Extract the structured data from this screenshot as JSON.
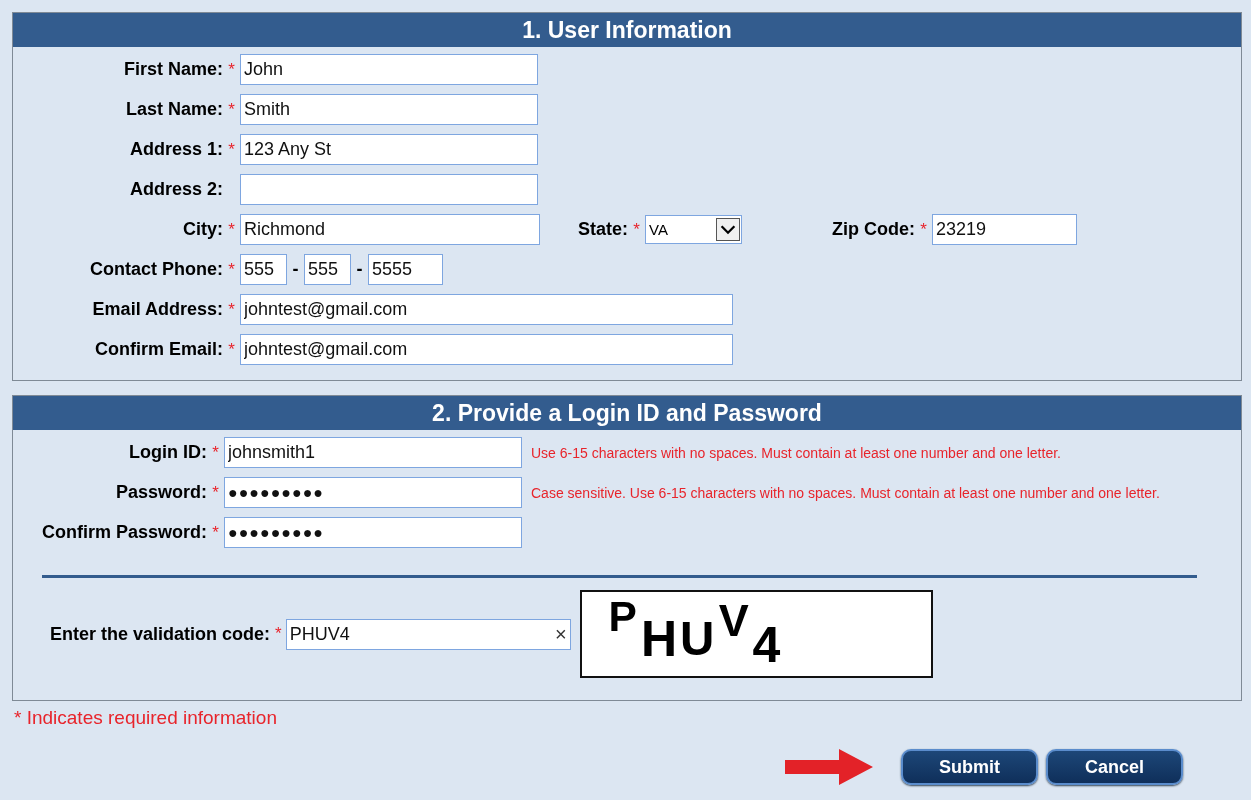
{
  "sections": [
    {
      "title": "1. User Information",
      "rows": [
        {
          "kind": "text",
          "label": "First Name:",
          "mark": "*",
          "value": "John"
        },
        {
          "kind": "text",
          "label": "Last Name:",
          "mark": "*",
          "value": "Smith"
        },
        {
          "kind": "text",
          "label": "Address 1:",
          "mark": "*",
          "value": "123 Any St"
        },
        {
          "kind": "text",
          "label": "Address 2:"
        },
        {
          "kind": "city",
          "label": "City:",
          "mark": "*",
          "value": "Richmond",
          "extras": [
            {
              "kind": "select",
              "label": "State:",
              "mark": "*",
              "value": "VA"
            },
            {
              "kind": "zip",
              "label": "Zip Code:",
              "mark": "*",
              "value": "23219"
            }
          ]
        },
        {
          "kind": "phone",
          "label": "Contact Phone:",
          "mark": "*",
          "parts": [
            "555",
            "555",
            "5555"
          ],
          "separators": [
            "-",
            "-"
          ]
        },
        {
          "kind": "email",
          "label": "Email Address:",
          "mark": "*",
          "value": "johntest@gmail.com"
        },
        {
          "kind": "email",
          "label": "Confirm Email:",
          "mark": "*",
          "value": "johntest@gmail.com"
        }
      ]
    },
    {
      "title": "2. Provide a Login ID and Password",
      "rows": [
        {
          "kind": "text",
          "label": "Login ID:",
          "mark": "*",
          "value": "johnsmith1",
          "hint": "Use 6-15 characters with no spaces. Must contain at least one number and one letter."
        },
        {
          "kind": "password",
          "label": "Password:",
          "mark": "*",
          "value": "●●●●●●●●●",
          "hint": "Case sensitive. Use 6-15 characters with no spaces. Must contain at least one number and one letter."
        },
        {
          "kind": "password",
          "label": "Confirm Password:",
          "mark": "*",
          "value": "●●●●●●●●●"
        }
      ],
      "validation": {
        "label": "Enter the validation code:",
        "mark": "*",
        "value": "PHUV4",
        "clear": "×",
        "captcha": "PHUV4"
      }
    }
  ],
  "note": "* Indicates required information",
  "buttons": [
    "Submit",
    "Cancel"
  ]
}
